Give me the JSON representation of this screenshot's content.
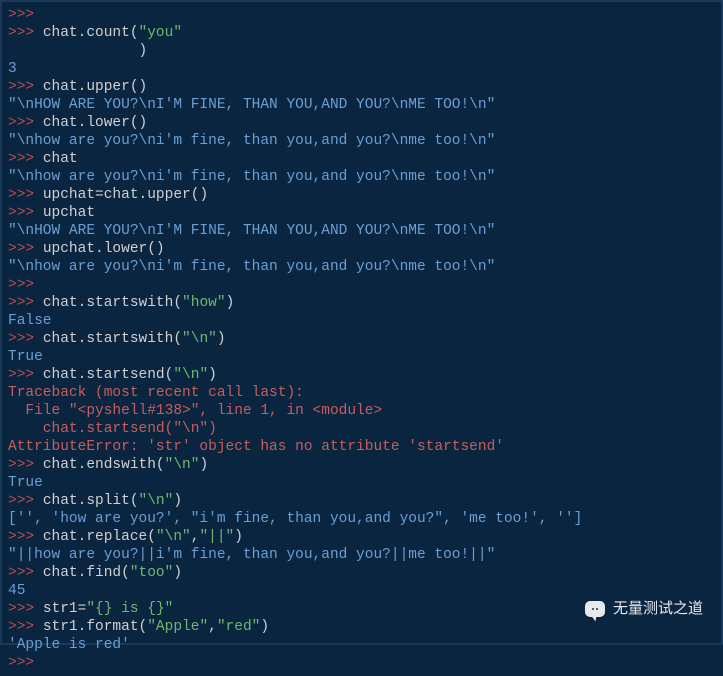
{
  "prompt": ">>> ",
  "lines": [
    {
      "segments": [
        {
          "cls": "prompt",
          "k": "prompt"
        }
      ]
    },
    {
      "segments": [
        {
          "cls": "prompt",
          "k": "prompt"
        },
        {
          "cls": "code",
          "t": "chat.count("
        },
        {
          "cls": "str",
          "t": "\"you\""
        }
      ]
    },
    {
      "segments": [
        {
          "cls": "code",
          "t": "               )"
        }
      ]
    },
    {
      "segments": [
        {
          "cls": "out",
          "t": "3"
        }
      ]
    },
    {
      "segments": [
        {
          "cls": "prompt",
          "k": "prompt"
        },
        {
          "cls": "code",
          "t": "chat.upper()"
        }
      ]
    },
    {
      "segments": [
        {
          "cls": "out",
          "t": "\"\\nHOW ARE YOU?\\nI'M FINE, THAN YOU,AND YOU?\\nME TOO!\\n\""
        }
      ]
    },
    {
      "segments": [
        {
          "cls": "prompt",
          "k": "prompt"
        },
        {
          "cls": "code",
          "t": "chat.lower()"
        }
      ]
    },
    {
      "segments": [
        {
          "cls": "out",
          "t": "\"\\nhow are you?\\ni'm fine, than you,and you?\\nme too!\\n\""
        }
      ]
    },
    {
      "segments": [
        {
          "cls": "prompt",
          "k": "prompt"
        },
        {
          "cls": "code",
          "t": "chat"
        }
      ]
    },
    {
      "segments": [
        {
          "cls": "out",
          "t": "\"\\nhow are you?\\ni'm fine, than you,and you?\\nme too!\\n\""
        }
      ]
    },
    {
      "segments": [
        {
          "cls": "prompt",
          "k": "prompt"
        },
        {
          "cls": "code",
          "t": "upchat=chat.upper()"
        }
      ]
    },
    {
      "segments": [
        {
          "cls": "prompt",
          "k": "prompt"
        },
        {
          "cls": "code",
          "t": "upchat"
        }
      ]
    },
    {
      "segments": [
        {
          "cls": "out",
          "t": "\"\\nHOW ARE YOU?\\nI'M FINE, THAN YOU,AND YOU?\\nME TOO!\\n\""
        }
      ]
    },
    {
      "segments": [
        {
          "cls": "prompt",
          "k": "prompt"
        },
        {
          "cls": "code",
          "t": "upchat.lower()"
        }
      ]
    },
    {
      "segments": [
        {
          "cls": "out",
          "t": "\"\\nhow are you?\\ni'm fine, than you,and you?\\nme too!\\n\""
        }
      ]
    },
    {
      "segments": [
        {
          "cls": "prompt",
          "k": "prompt"
        }
      ]
    },
    {
      "segments": [
        {
          "cls": "prompt",
          "k": "prompt"
        },
        {
          "cls": "code",
          "t": "chat.startswith("
        },
        {
          "cls": "str",
          "t": "\"how\""
        },
        {
          "cls": "code",
          "t": ")"
        }
      ]
    },
    {
      "segments": [
        {
          "cls": "out",
          "t": "False"
        }
      ]
    },
    {
      "segments": [
        {
          "cls": "prompt",
          "k": "prompt"
        },
        {
          "cls": "code",
          "t": "chat.startswith("
        },
        {
          "cls": "str",
          "t": "\"\\n\""
        },
        {
          "cls": "code",
          "t": ")"
        }
      ]
    },
    {
      "segments": [
        {
          "cls": "out",
          "t": "True"
        }
      ]
    },
    {
      "segments": [
        {
          "cls": "prompt",
          "k": "prompt"
        },
        {
          "cls": "code",
          "t": "chat.startsend("
        },
        {
          "cls": "str",
          "t": "\"\\n\""
        },
        {
          "cls": "code",
          "t": ")"
        }
      ]
    },
    {
      "segments": [
        {
          "cls": "err",
          "t": "Traceback (most recent call last):"
        }
      ]
    },
    {
      "segments": [
        {
          "cls": "err",
          "t": "  File \"<pyshell#138>\", line 1, in <module>"
        }
      ]
    },
    {
      "segments": [
        {
          "cls": "err",
          "t": "    chat.startsend(\"\\n\")"
        }
      ]
    },
    {
      "segments": [
        {
          "cls": "err",
          "t": "AttributeError: 'str' object has no attribute 'startsend'"
        }
      ]
    },
    {
      "segments": [
        {
          "cls": "prompt",
          "k": "prompt"
        },
        {
          "cls": "code",
          "t": "chat.endswith("
        },
        {
          "cls": "str",
          "t": "\"\\n\""
        },
        {
          "cls": "code",
          "t": ")"
        }
      ]
    },
    {
      "segments": [
        {
          "cls": "out",
          "t": "True"
        }
      ]
    },
    {
      "segments": [
        {
          "cls": "prompt",
          "k": "prompt"
        },
        {
          "cls": "code",
          "t": "chat.split("
        },
        {
          "cls": "str",
          "t": "\"\\n\""
        },
        {
          "cls": "code",
          "t": ")"
        }
      ]
    },
    {
      "segments": [
        {
          "cls": "out",
          "t": "['', 'how are you?', \"i'm fine, than you,and you?\", 'me too!', '']"
        }
      ]
    },
    {
      "segments": [
        {
          "cls": "prompt",
          "k": "prompt"
        },
        {
          "cls": "code",
          "t": "chat.replace("
        },
        {
          "cls": "str",
          "t": "\"\\n\""
        },
        {
          "cls": "code",
          "t": ","
        },
        {
          "cls": "str",
          "t": "\"||\""
        },
        {
          "cls": "code",
          "t": ")"
        }
      ]
    },
    {
      "segments": [
        {
          "cls": "out",
          "t": "\"||how are you?||i'm fine, than you,and you?||me too!||\""
        }
      ]
    },
    {
      "segments": [
        {
          "cls": "prompt",
          "k": "prompt"
        },
        {
          "cls": "code",
          "t": "chat.find("
        },
        {
          "cls": "str",
          "t": "\"too\""
        },
        {
          "cls": "code",
          "t": ")"
        }
      ]
    },
    {
      "segments": [
        {
          "cls": "out",
          "t": "45"
        }
      ]
    },
    {
      "segments": [
        {
          "cls": "prompt",
          "k": "prompt"
        },
        {
          "cls": "code",
          "t": "str1="
        },
        {
          "cls": "str",
          "t": "\"{} is {}\""
        }
      ]
    },
    {
      "segments": [
        {
          "cls": "prompt",
          "k": "prompt"
        },
        {
          "cls": "code",
          "t": "str1.format("
        },
        {
          "cls": "str",
          "t": "\"Apple\""
        },
        {
          "cls": "code",
          "t": ","
        },
        {
          "cls": "str",
          "t": "\"red\""
        },
        {
          "cls": "code",
          "t": ")"
        }
      ]
    },
    {
      "segments": [
        {
          "cls": "out",
          "t": "'Apple is red'"
        }
      ]
    },
    {
      "segments": [
        {
          "cls": "prompt",
          "k": "prompt"
        }
      ]
    }
  ],
  "watermark_text": "无量测试之道"
}
